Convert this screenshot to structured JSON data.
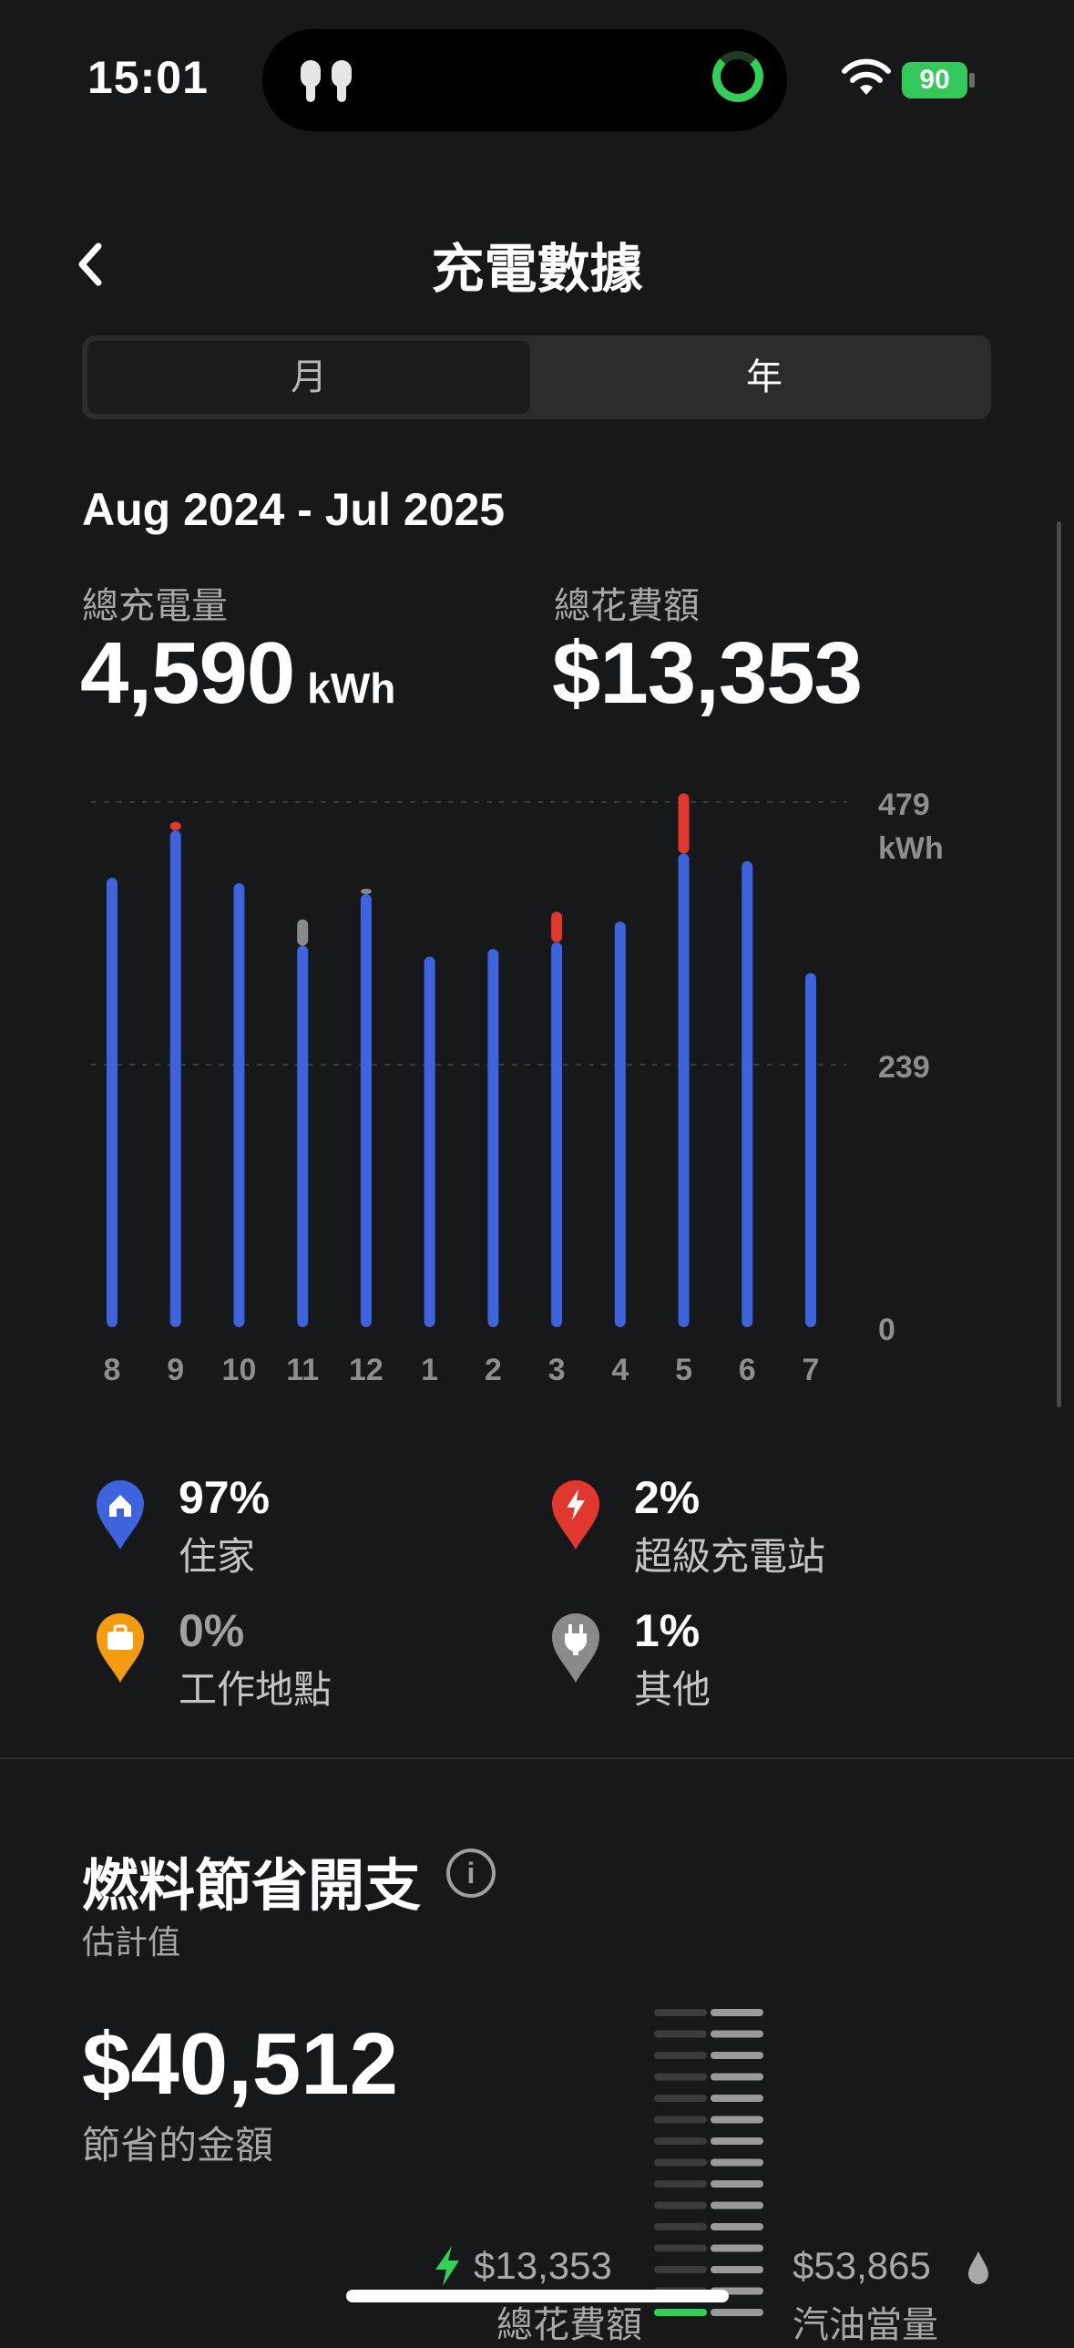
{
  "status": {
    "time": "15:01",
    "battery": "90"
  },
  "header": {
    "title": "充電數據"
  },
  "tabs": [
    {
      "label": "月",
      "selected": false
    },
    {
      "label": "年",
      "selected": true
    }
  ],
  "range_label": "Aug 2024 - Jul 2025",
  "totals": {
    "energy_label": "總充電量",
    "energy_value": "4,590",
    "energy_unit": "kWh",
    "cost_label": "總花費額",
    "cost_value": "$13,353"
  },
  "chart_data": {
    "type": "bar",
    "stacked": true,
    "categories": [
      "8",
      "9",
      "10",
      "11",
      "12",
      "1",
      "2",
      "3",
      "4",
      "5",
      "6",
      "7"
    ],
    "series": [
      {
        "name": "住家",
        "color": "#3d63dd",
        "values": [
          410,
          453,
          405,
          348,
          395,
          338,
          345,
          351,
          370,
          432,
          425,
          323
        ]
      },
      {
        "name": "超級充電站",
        "color": "#e0382f",
        "values": [
          0,
          8,
          0,
          0,
          0,
          0,
          0,
          28,
          0,
          55,
          0,
          0
        ]
      },
      {
        "name": "其他",
        "color": "#8a8a8c",
        "values": [
          0,
          0,
          0,
          24,
          5,
          0,
          0,
          0,
          0,
          0,
          0,
          0
        ]
      }
    ],
    "y_ticks": [
      "0",
      "239",
      "479"
    ],
    "y_unit": "kWh",
    "ylim": [
      0,
      479
    ],
    "grid": true,
    "axis_position": "right"
  },
  "legend": [
    {
      "percent": "97%",
      "label": "住家",
      "color": "#3d63dd",
      "icon": "home-icon"
    },
    {
      "percent": "2%",
      "label": "超級充電站",
      "color": "#e0382f",
      "icon": "lightning-icon"
    },
    {
      "percent": "0%",
      "label": "工作地點",
      "color": "#f39c12",
      "icon": "briefcase-icon"
    },
    {
      "percent": "1%",
      "label": "其他",
      "color": "#8a8a8c",
      "icon": "plug-icon"
    }
  ],
  "fuel": {
    "title": "燃料節省開支",
    "estimate_label": "估計值",
    "savings_value": "$40,512",
    "savings_label": "節省的金額",
    "total_cost_value": "$13,353",
    "total_cost_label": "總花費額",
    "gas_equivalent_value": "$53,865",
    "gas_equivalent_label": "汽油當量"
  }
}
